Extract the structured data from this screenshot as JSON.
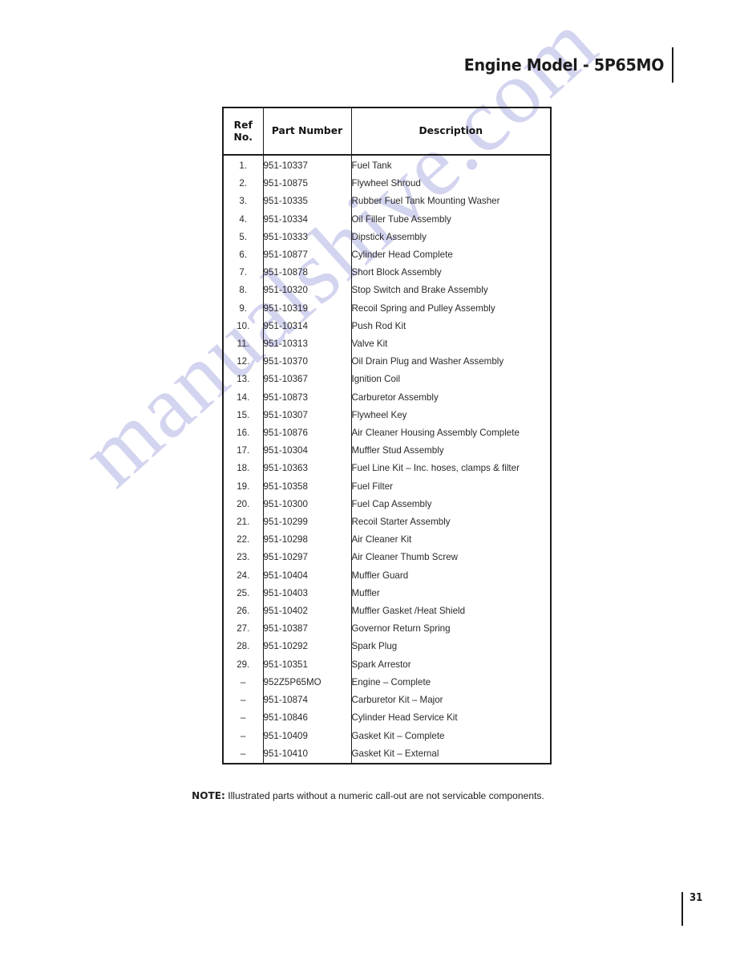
{
  "page": {
    "header_title": "Engine Model - 5P65MO",
    "page_number": "31",
    "watermark": "manualshive.com",
    "accent_color": "#1b1b1b",
    "watermark_color": "#b9bbe6"
  },
  "note": {
    "label": "NOTE:",
    "text": " Illustrated parts without a numeric call-out are not servicable components."
  },
  "table": {
    "columns": [
      "Ref No.",
      "Part Number",
      "Description"
    ],
    "header_ref_line1": "Ref",
    "header_ref_line2": "No.",
    "header_part": "Part Number",
    "header_desc": "Description",
    "rows": [
      {
        "ref": "1.",
        "part": "951-10337",
        "desc": "Fuel Tank"
      },
      {
        "ref": "2.",
        "part": "951-10875",
        "desc": "Flywheel Shroud"
      },
      {
        "ref": "3.",
        "part": "951-10335",
        "desc": "Rubber Fuel Tank Mounting Washer"
      },
      {
        "ref": "4.",
        "part": "951-10334",
        "desc": "Oil Filler Tube Assembly"
      },
      {
        "ref": "5.",
        "part": "951-10333",
        "desc": "Dipstick Assembly"
      },
      {
        "ref": "6.",
        "part": "951-10877",
        "desc": "Cylinder Head Complete"
      },
      {
        "ref": "7.",
        "part": "951-10878",
        "desc": "Short Block Assembly"
      },
      {
        "ref": "8.",
        "part": "951-10320",
        "desc": "Stop Switch and Brake Assembly"
      },
      {
        "ref": "9.",
        "part": "951-10319",
        "desc": "Recoil Spring and Pulley Assembly"
      },
      {
        "ref": "10.",
        "part": "951-10314",
        "desc": "Push Rod Kit"
      },
      {
        "ref": "11.",
        "part": "951-10313",
        "desc": "Valve Kit"
      },
      {
        "ref": "12.",
        "part": "951-10370",
        "desc": "Oil Drain Plug and Washer Assembly"
      },
      {
        "ref": "13.",
        "part": "951-10367",
        "desc": "Ignition Coil"
      },
      {
        "ref": "14.",
        "part": "951-10873",
        "desc": "Carburetor Assembly"
      },
      {
        "ref": "15.",
        "part": "951-10307",
        "desc": "Flywheel Key"
      },
      {
        "ref": "16.",
        "part": "951-10876",
        "desc": "Air Cleaner Housing Assembly Complete"
      },
      {
        "ref": "17.",
        "part": "951-10304",
        "desc": "Muffler Stud Assembly"
      },
      {
        "ref": "18.",
        "part": "951-10363",
        "desc": "Fuel Line Kit – Inc. hoses, clamps & filter"
      },
      {
        "ref": "19.",
        "part": "951-10358",
        "desc": "Fuel Filter"
      },
      {
        "ref": "20.",
        "part": "951-10300",
        "desc": "Fuel Cap Assembly"
      },
      {
        "ref": "21.",
        "part": "951-10299",
        "desc": "Recoil Starter Assembly"
      },
      {
        "ref": "22.",
        "part": "951-10298",
        "desc": "Air Cleaner Kit"
      },
      {
        "ref": "23.",
        "part": "951-10297",
        "desc": "Air Cleaner Thumb Screw"
      },
      {
        "ref": "24.",
        "part": "951-10404",
        "desc": "Muffler Guard"
      },
      {
        "ref": "25.",
        "part": "951-10403",
        "desc": "Muffler"
      },
      {
        "ref": "26.",
        "part": "951-10402",
        "desc": "Muffler Gasket /Heat Shield"
      },
      {
        "ref": "27.",
        "part": "951-10387",
        "desc": "Governor Return Spring"
      },
      {
        "ref": "28.",
        "part": "951-10292",
        "desc": "Spark Plug"
      },
      {
        "ref": "29.",
        "part": "951-10351",
        "desc": "Spark Arrestor"
      },
      {
        "ref": "–",
        "part": "952Z5P65MO",
        "desc": "Engine – Complete"
      },
      {
        "ref": "–",
        "part": "951-10874",
        "desc": "Carburetor Kit – Major"
      },
      {
        "ref": "–",
        "part": "951-10846",
        "desc": "Cylinder Head Service Kit"
      },
      {
        "ref": "–",
        "part": "951-10409",
        "desc": "Gasket Kit – Complete"
      },
      {
        "ref": "–",
        "part": "951-10410",
        "desc": "Gasket Kit – External"
      }
    ]
  }
}
